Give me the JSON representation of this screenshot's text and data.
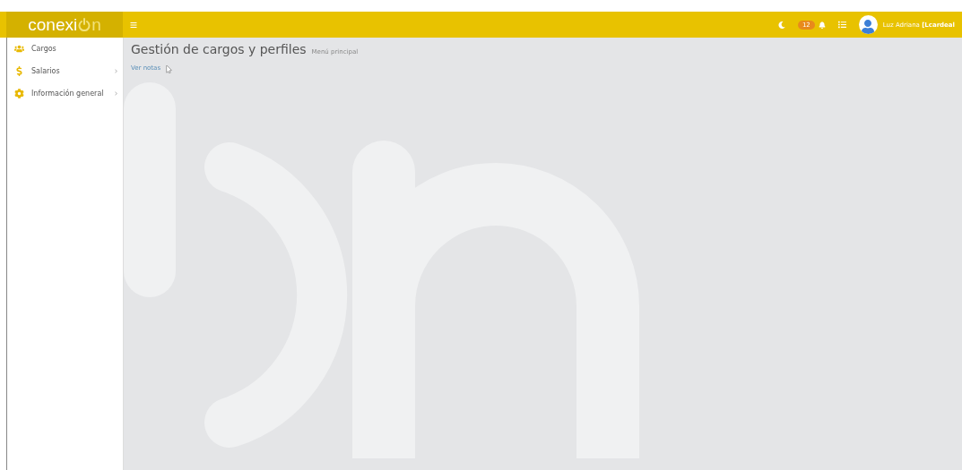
{
  "logo": {
    "text": "conexi",
    "suffix": "n"
  },
  "header": {
    "notification_count": "12",
    "user_name": "Luz Adriana ",
    "user_login": "[Lcardeal"
  },
  "sidebar": {
    "items": [
      {
        "label": "Cargos",
        "expandable": false
      },
      {
        "label": "Salarios",
        "expandable": true
      },
      {
        "label": "Información general",
        "expandable": true
      }
    ]
  },
  "page": {
    "title": "Gestión de cargos y perfiles",
    "subtitle": "Menú principal",
    "link": "Ver notas"
  }
}
